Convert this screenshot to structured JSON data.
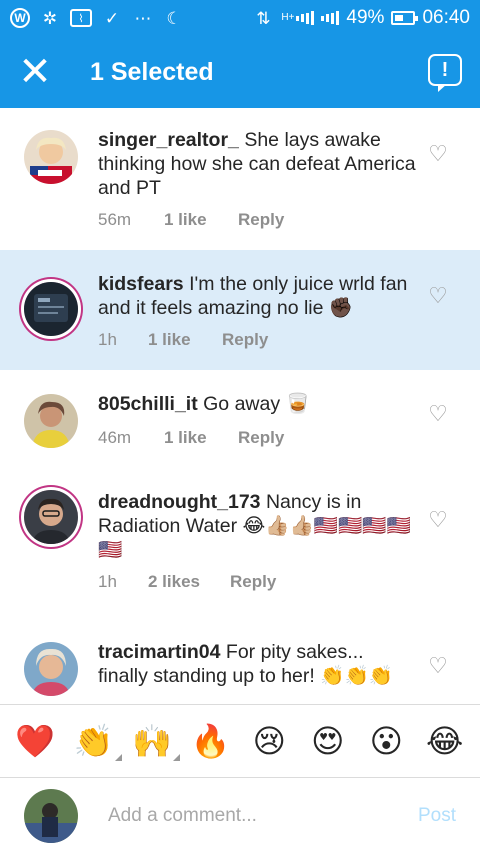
{
  "status_bar": {
    "battery_percent_text": "49%",
    "battery_level": 0.49,
    "time": "06:40",
    "network_label": "H+",
    "icons": [
      "wordpress-icon",
      "shutter-icon",
      "activity-icon",
      "download-done-icon",
      "more-dots-icon",
      "moon-icon",
      "data-transfer-icon",
      "signal-icon",
      "signal-icon",
      "battery-icon"
    ]
  },
  "app_bar": {
    "title": "1 Selected",
    "close_icon": "close-icon",
    "report_icon": "report-icon"
  },
  "colors": {
    "accent": "#1796e6",
    "selected_row": "#dcecf9",
    "meta_text": "#8e8e8e",
    "post_disabled": "#b2dffc"
  },
  "comments": [
    {
      "username": "singer_realtor_",
      "text": "She lays awake thinking how she can defeat America and PT",
      "time": "56m",
      "likes": "1 like",
      "reply": "Reply",
      "selected": false
    },
    {
      "username": "kidsfears",
      "text": "I'm the only juice wrld fan and it feels amazing no lie ✊🏿",
      "time": "1h",
      "likes": "1 like",
      "reply": "Reply",
      "selected": true
    },
    {
      "username": "805chilli_it",
      "text": "Go away 🥃",
      "time": "46m",
      "likes": "1 like",
      "reply": "Reply",
      "selected": false
    },
    {
      "username": "dreadnought_173",
      "text": "Nancy is in Radiation Water 😂👍🏼👍🏼🇺🇸🇺🇸🇺🇸🇺🇸🇺🇸",
      "time": "1h",
      "likes": "2 likes",
      "reply": "Reply",
      "selected": false
    },
    {
      "username": "tracimartin04",
      "text": "For pity sakes... finally standing up to her! 👏👏👏",
      "selected": false
    }
  ],
  "emoji_bar": [
    "❤️",
    "👏",
    "🙌",
    "🔥",
    "😢",
    "😍",
    "😮",
    "😂"
  ],
  "composer": {
    "placeholder": "Add a comment...",
    "post_label": "Post"
  }
}
